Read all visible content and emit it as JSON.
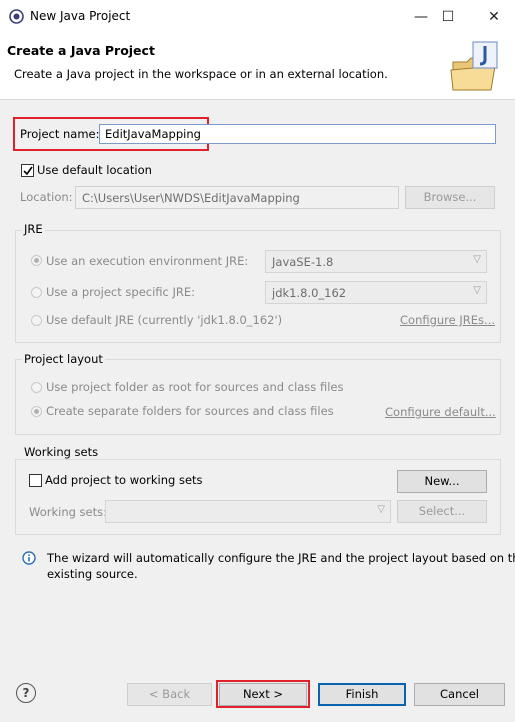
{
  "window": {
    "title": "New Java Project",
    "minimize_glyph": "—",
    "maximize_glyph": "☐",
    "close_glyph": "✕"
  },
  "header": {
    "title": "Create a Java Project",
    "subtitle": "Create a Java project in the workspace or in an external location."
  },
  "project": {
    "name_label": "Project name:",
    "name_value": "EditJavaMapping"
  },
  "location": {
    "use_default_label": "Use default location",
    "use_default_checked": true,
    "label": "Location:",
    "value": "C:\\Users\\User\\NWDS\\EditJavaMapping",
    "browse_label": "Browse..."
  },
  "jre": {
    "group_title": "JRE",
    "env_label": "Use an execution environment JRE:",
    "env_value": "JavaSE-1.8",
    "specific_label": "Use a project specific JRE:",
    "specific_value": "jdk1.8.0_162",
    "default_label": "Use default JRE (currently 'jdk1.8.0_162')",
    "configure_link": "Configure JREs..."
  },
  "layout": {
    "group_title": "Project layout",
    "root_label": "Use project folder as root for sources and class files",
    "separate_label": "Create separate folders for sources and class files",
    "configure_link": "Configure default..."
  },
  "working_sets": {
    "group_title": "Working sets",
    "add_label": "Add project to working sets",
    "new_label": "New...",
    "sets_label": "Working sets:",
    "select_label": "Select..."
  },
  "info": {
    "text_line1": "The wizard will automatically configure the JRE and the project layout based on the",
    "text_line2": "existing source."
  },
  "buttons": {
    "help": "?",
    "back": "< Back",
    "next": "Next >",
    "finish": "Finish",
    "cancel": "Cancel"
  },
  "colors": {
    "highlight_red": "#e0202a",
    "accent_blue": "#0a64ad"
  }
}
